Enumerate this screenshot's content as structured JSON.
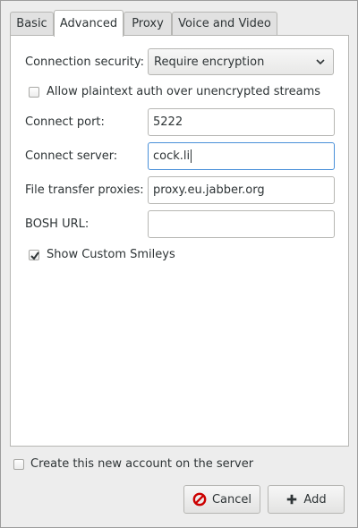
{
  "tabs": [
    {
      "label": "Basic",
      "active": false
    },
    {
      "label": "Advanced",
      "active": true
    },
    {
      "label": "Proxy",
      "active": false
    },
    {
      "label": "Voice and Video",
      "active": false
    }
  ],
  "advanced": {
    "connection_security": {
      "label": "Connection security:",
      "value": "Require encryption"
    },
    "allow_plaintext": {
      "label": "Allow plaintext auth over unencrypted streams",
      "checked": false
    },
    "connect_port": {
      "label": "Connect port:",
      "value": "5222"
    },
    "connect_server": {
      "label": "Connect server:",
      "value": "cock.li"
    },
    "file_transfer_proxies": {
      "label": "File transfer proxies:",
      "value": "proxy.eu.jabber.org"
    },
    "bosh_url": {
      "label": "BOSH URL:",
      "value": ""
    },
    "show_custom_smileys": {
      "label": "Show Custom Smileys",
      "checked": true
    }
  },
  "footer": {
    "create_account": {
      "label": "Create this new account on the server",
      "checked": false
    },
    "cancel_label": "Cancel",
    "add_label": "Add"
  },
  "colors": {
    "cancel_icon": "#cc0000",
    "focus_border": "#4a90d9"
  }
}
